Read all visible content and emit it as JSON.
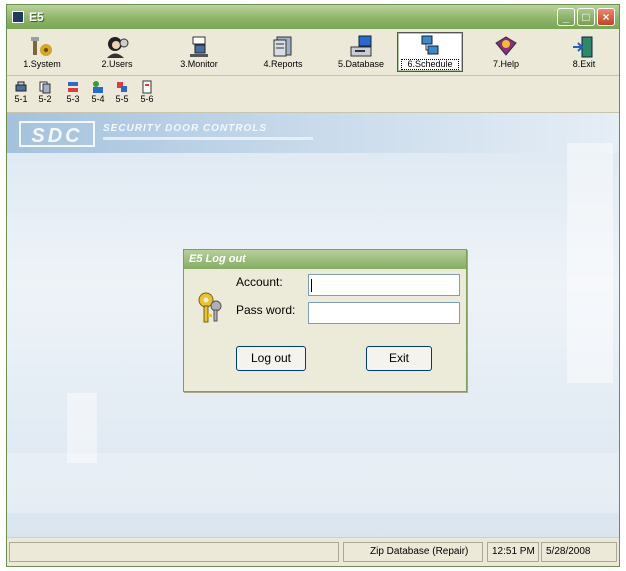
{
  "window": {
    "title": "E5"
  },
  "main_toolbar": [
    {
      "label": "1.System",
      "icon": "system-icon",
      "active": false
    },
    {
      "label": "2.Users",
      "icon": "users-icon",
      "active": false
    },
    {
      "label": "3.Monitor",
      "icon": "monitor-icon",
      "active": false
    },
    {
      "label": "4.Reports",
      "icon": "reports-icon",
      "active": false
    },
    {
      "label": "5.Database",
      "icon": "database-icon",
      "active": false
    },
    {
      "label": "6.Schedule",
      "icon": "schedule-icon",
      "active": true
    },
    {
      "label": "7.Help",
      "icon": "help-book-icon",
      "active": false
    },
    {
      "label": "8.Exit",
      "icon": "exit-door-icon",
      "active": false
    }
  ],
  "sub_toolbar": [
    {
      "label": "5-1",
      "icon": "sub-tool-icon"
    },
    {
      "label": "5-2",
      "icon": "sub-tool-icon"
    },
    {
      "label": "5-3",
      "icon": "sub-tool-icon"
    },
    {
      "label": "5-4",
      "icon": "sub-tool-icon"
    },
    {
      "label": "5-5",
      "icon": "sub-tool-icon"
    },
    {
      "label": "5-6",
      "icon": "sub-tool-icon"
    }
  ],
  "banner": {
    "logo": "SDC",
    "company": "SECURITY DOOR CONTROLS"
  },
  "logout_dialog": {
    "title": "E5 Log out",
    "account_label": "Account:",
    "account_value": "",
    "password_label": "Pass word:",
    "password_value": "",
    "logout_button": "Log out",
    "exit_button": "Exit"
  },
  "statusbar": {
    "left": "",
    "database": "Zip Database (Repair)",
    "time": "12:51 PM",
    "date": "5/28/2008"
  },
  "colors": {
    "title_green": "#86ac62",
    "panel": "#ece9d8",
    "client_blue": "#dce7f1"
  }
}
